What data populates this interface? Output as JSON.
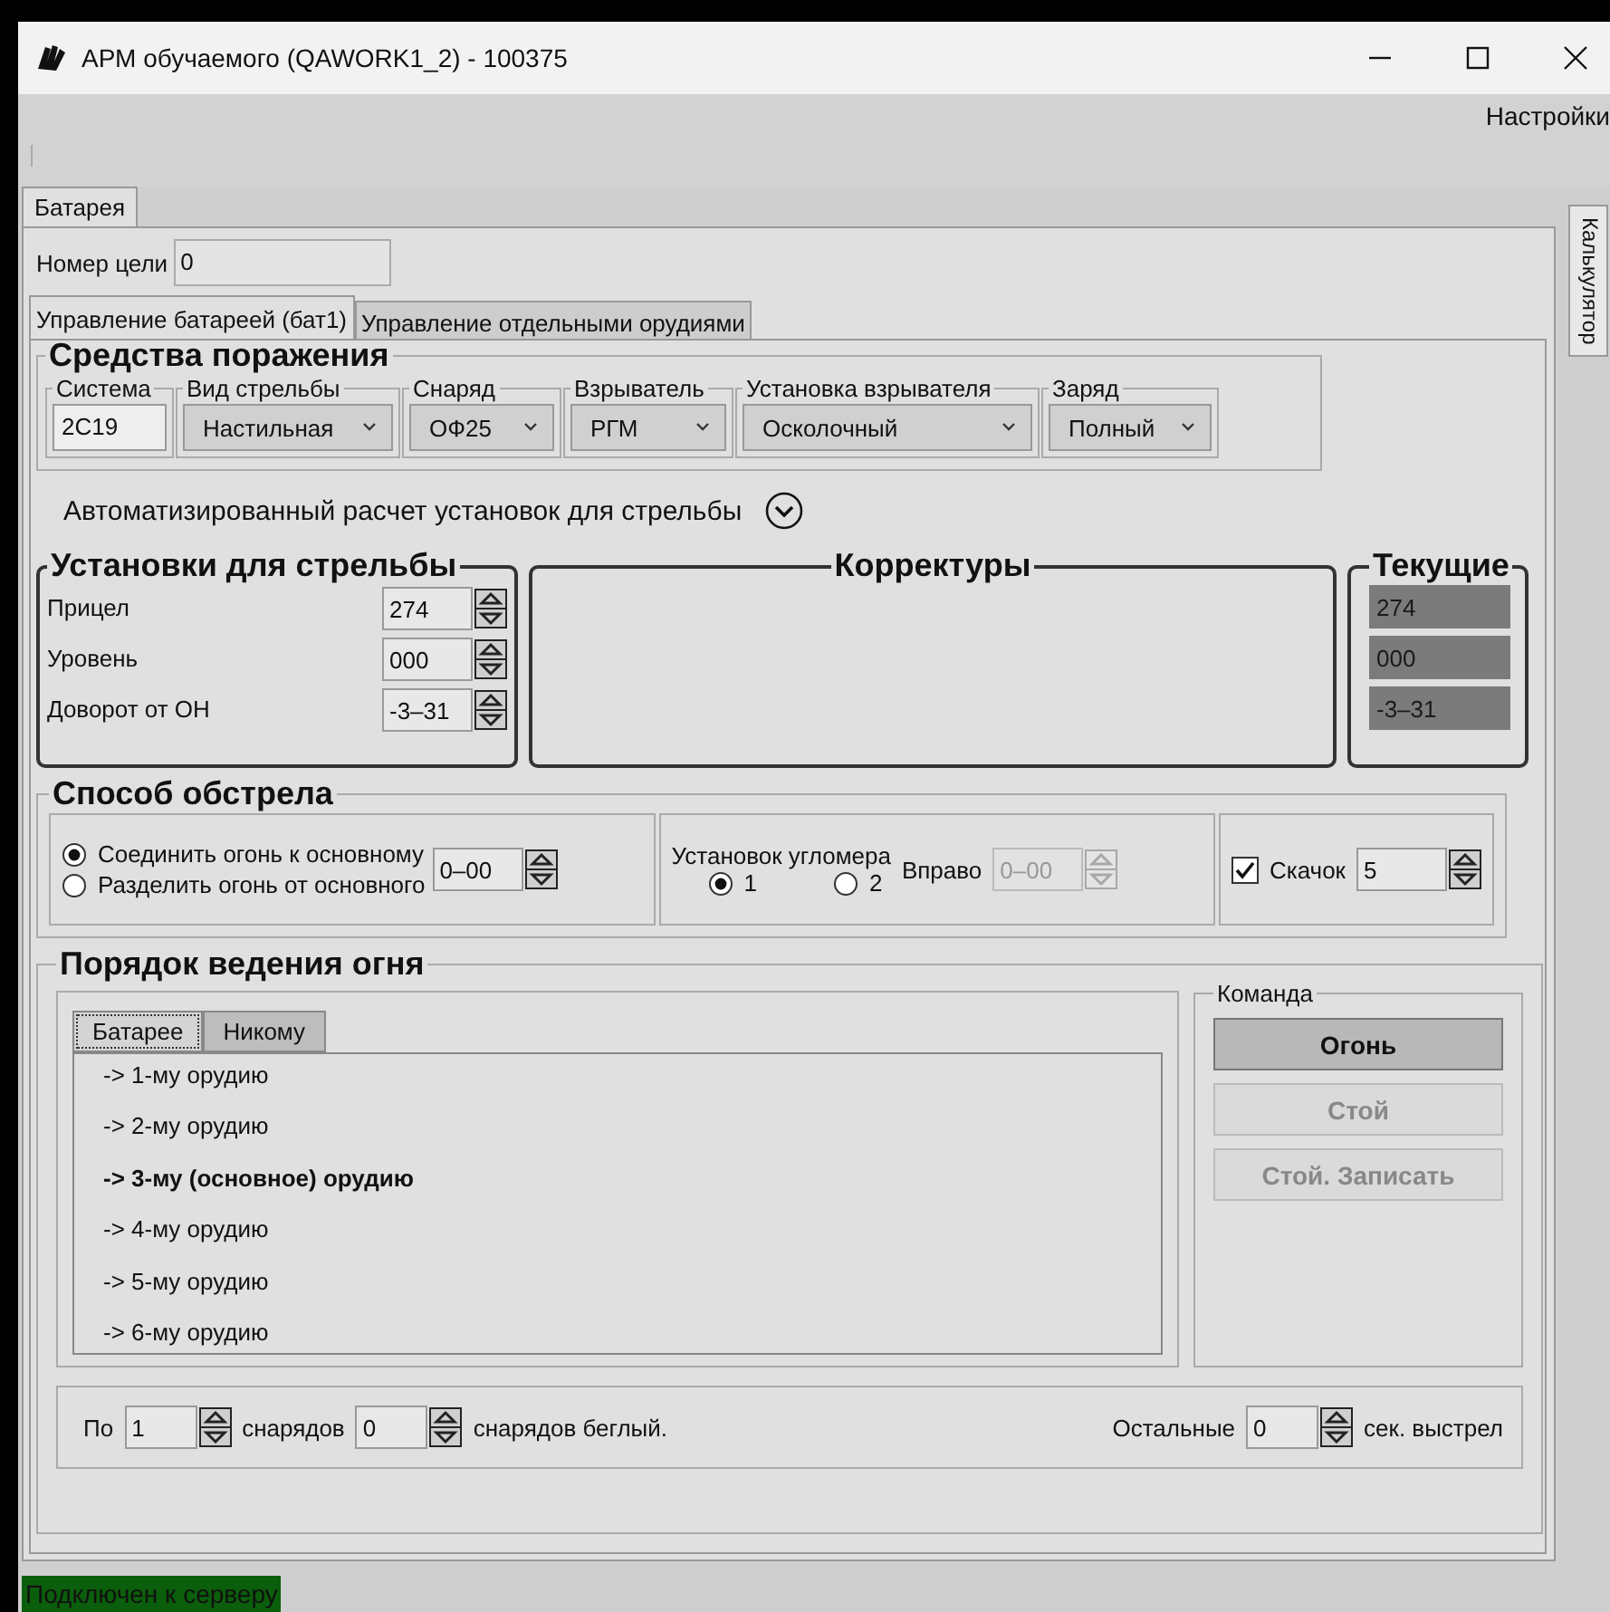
{
  "window": {
    "title": "АРМ обучаемого (QAWORK1_2) - 100375"
  },
  "menu": [
    "Настройки"
  ],
  "side_tab": {
    "label": "Калькулятор",
    "selected": false
  },
  "outer_tabs": [
    {
      "label": "Батарея",
      "selected": true
    }
  ],
  "target_number": {
    "label": "Номер цели",
    "value": "0"
  },
  "inner_tabs": [
    {
      "label": "Управление батареей (бат1)",
      "selected": true
    },
    {
      "label": "Управление отдельными орудиями",
      "selected": false
    }
  ],
  "weapons": {
    "title": "Средства поражения",
    "fields": [
      {
        "label": "Система",
        "value": "2С19",
        "kind": "text"
      },
      {
        "label": "Вид стрельбы",
        "value": "Настильная",
        "kind": "dropdown"
      },
      {
        "label": "Снаряд",
        "value": "ОФ25",
        "kind": "dropdown"
      },
      {
        "label": "Взрыватель",
        "value": "РГМ",
        "kind": "dropdown"
      },
      {
        "label": "Установка взрывателя",
        "value": "Осколочный",
        "kind": "dropdown"
      },
      {
        "label": "Заряд",
        "value": "Полный",
        "kind": "dropdown"
      }
    ]
  },
  "auto_calc": {
    "label": "Автоматизированный расчет установок для стрельбы",
    "expanded": false
  },
  "firing_settings": {
    "title": "Установки для стрельбы",
    "rows": [
      {
        "label": "Прицел",
        "value": "274"
      },
      {
        "label": "Уровень",
        "value": "000"
      },
      {
        "label": "Доворот от ОН",
        "value": "-3–31"
      }
    ]
  },
  "corrections": {
    "title": "Корректуры"
  },
  "current": {
    "title": "Текущие",
    "values": [
      "274",
      "000",
      "-3–31"
    ]
  },
  "fire_method": {
    "title": "Способ обстрела",
    "modes": [
      {
        "label": "Соединить огонь к основному",
        "selected": true
      },
      {
        "label": "Разделить огонь от основного",
        "selected": false
      }
    ],
    "mode_value": "0–00",
    "goniometer": {
      "label": "Установок угломера",
      "options": [
        {
          "label": "1",
          "selected": true
        },
        {
          "label": "2",
          "selected": false
        }
      ]
    },
    "right": {
      "label": "Вправо",
      "value": "0–00",
      "disabled": true
    },
    "jump": {
      "label": "Скачок",
      "checked": true,
      "value": "5"
    }
  },
  "fire_order": {
    "title": "Порядок ведения огня",
    "tabs": [
      {
        "label": "Батарее",
        "selected": true
      },
      {
        "label": "Никому",
        "selected": false
      }
    ],
    "items": [
      {
        "label": "-> 1-му орудию",
        "main": false
      },
      {
        "label": "-> 2-му орудию",
        "main": false
      },
      {
        "label": "-> 3-му (основное) орудию",
        "main": true
      },
      {
        "label": "-> 4-му орудию",
        "main": false
      },
      {
        "label": "-> 5-му орудию",
        "main": false
      },
      {
        "label": "-> 6-му орудию",
        "main": false
      }
    ],
    "command": {
      "title": "Команда",
      "buttons": [
        {
          "label": "Огонь",
          "disabled": false
        },
        {
          "label": "Стой",
          "disabled": true
        },
        {
          "label": "Стой. Записать",
          "disabled": true
        }
      ]
    },
    "bottom": {
      "by_label": "По",
      "shells_value": "1",
      "shells_label": "снарядов",
      "rapid_value": "0",
      "rapid_label": "снарядов беглый.",
      "rest_label": "Остальные",
      "rest_value": "0",
      "rest_unit": "сек. выстрел"
    }
  },
  "status_bar": {
    "text": "Подключен к серверу",
    "connected": true
  }
}
